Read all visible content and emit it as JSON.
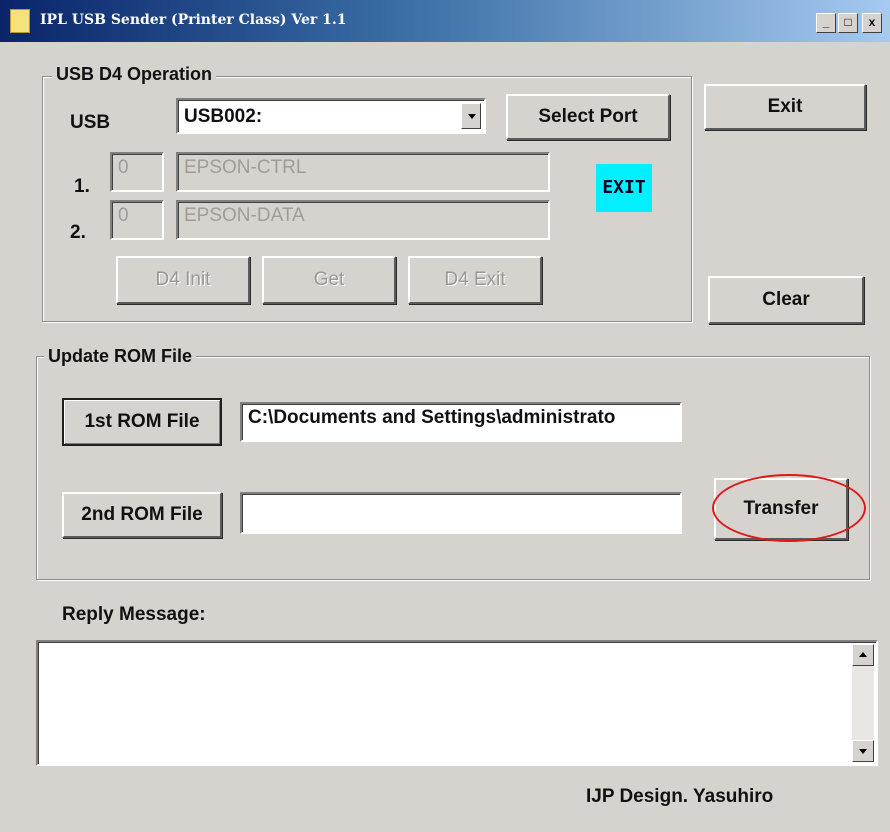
{
  "window": {
    "title": "IPL USB Sender (Printer Class)  Ver 1.1",
    "controls": {
      "minimize": "_",
      "maximize": "□",
      "close": "x"
    }
  },
  "usb_group": {
    "legend": "USB D4 Operation",
    "usb_label": "USB",
    "port_value": "USB002:",
    "select_port_label": "Select Port",
    "row1": {
      "index": "1.",
      "number": "0",
      "name": "EPSON-CTRL"
    },
    "row2": {
      "index": "2.",
      "number": "0",
      "name": "EPSON-DATA"
    },
    "status_badge": "EXIT",
    "d4_init_label": "D4 Init",
    "get_label": "Get",
    "d4_exit_label": "D4 Exit"
  },
  "side_buttons": {
    "exit_label": "Exit",
    "clear_label": "Clear"
  },
  "rom_group": {
    "legend": "Update ROM File",
    "first_rom_label": "1st ROM File",
    "first_rom_path": "C:\\Documents and Settings\\administrato",
    "second_rom_label": "2nd ROM File",
    "second_rom_path": "",
    "transfer_label": "Transfer"
  },
  "reply": {
    "label": "Reply Message:",
    "text": ""
  },
  "footer": {
    "credit": "IJP Design. Yasuhiro"
  },
  "colors": {
    "badge": "#00f0ff",
    "highlight_ring": "#e01818",
    "face": "#d6d3ce"
  }
}
